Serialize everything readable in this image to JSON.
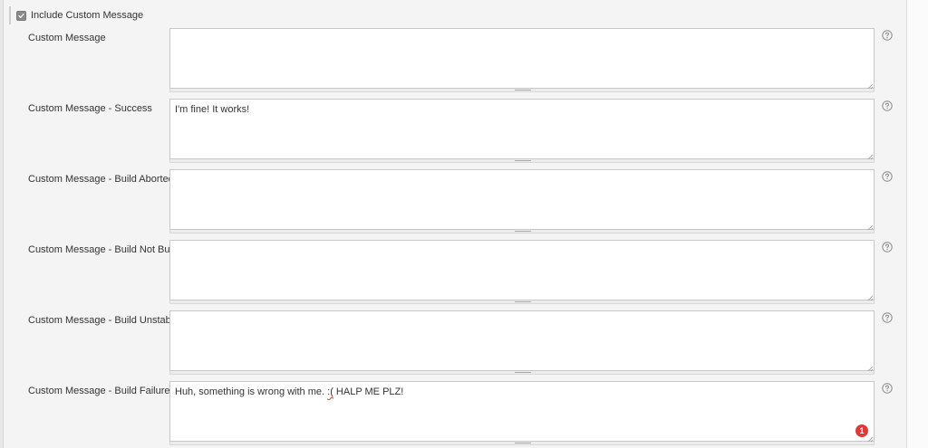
{
  "include_section": {
    "checkbox_checked": true,
    "label": "Include Custom Message"
  },
  "fields": [
    {
      "label": "Custom Message",
      "value": ""
    },
    {
      "label": "Custom Message - Success",
      "value": "I'm fine! It works!"
    },
    {
      "label": "Custom Message - Build Aborted",
      "value": ""
    },
    {
      "label": "Custom Message - Build Not Built",
      "value": ""
    },
    {
      "label": "Custom Message - Build Unstable",
      "value": ""
    },
    {
      "label": "Custom Message - Build Failure",
      "value_before": "Huh, something is wrong with me. ",
      "value_flagged": ":(",
      "value_after": " HALP ME PLZ!",
      "error_count": "1"
    }
  ],
  "icons": {
    "help": "help-circle-icon",
    "check": "checkmark-icon",
    "resize": "resize-corner-icon",
    "grip": "resize-grip-icon"
  },
  "colors": {
    "background": "#f4f4f4",
    "field_border": "#c8c8c8",
    "error_badge": "#db3b3b",
    "spell_underline": "#e03333"
  }
}
